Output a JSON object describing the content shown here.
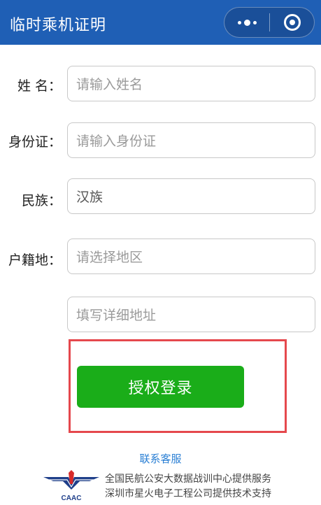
{
  "header": {
    "title": "临时乘机证明",
    "more_icon": "more-dots-icon",
    "close_icon": "target-close-icon"
  },
  "form": {
    "name": {
      "label": "姓 名：",
      "placeholder": "请输入姓名"
    },
    "id_card": {
      "label": "身份证：",
      "placeholder": "请输入身份证"
    },
    "ethnicity": {
      "label": "民族：",
      "value": "汉族"
    },
    "domicile": {
      "label": "户籍地：",
      "region_placeholder": "请选择地区",
      "address_placeholder": "填写详细地址"
    }
  },
  "actions": {
    "login_label": "授权登录"
  },
  "footer": {
    "contact_label": "联系客服",
    "logo_text": "CAAC",
    "line1": "全国民航公安大数据战训中心提供服务",
    "line2": "深圳市星火电子工程公司提供技术支持"
  },
  "colors": {
    "nav": "#1f5fb5",
    "button": "#1aad19",
    "highlight": "#e5484d",
    "link": "#2a7fd4"
  }
}
